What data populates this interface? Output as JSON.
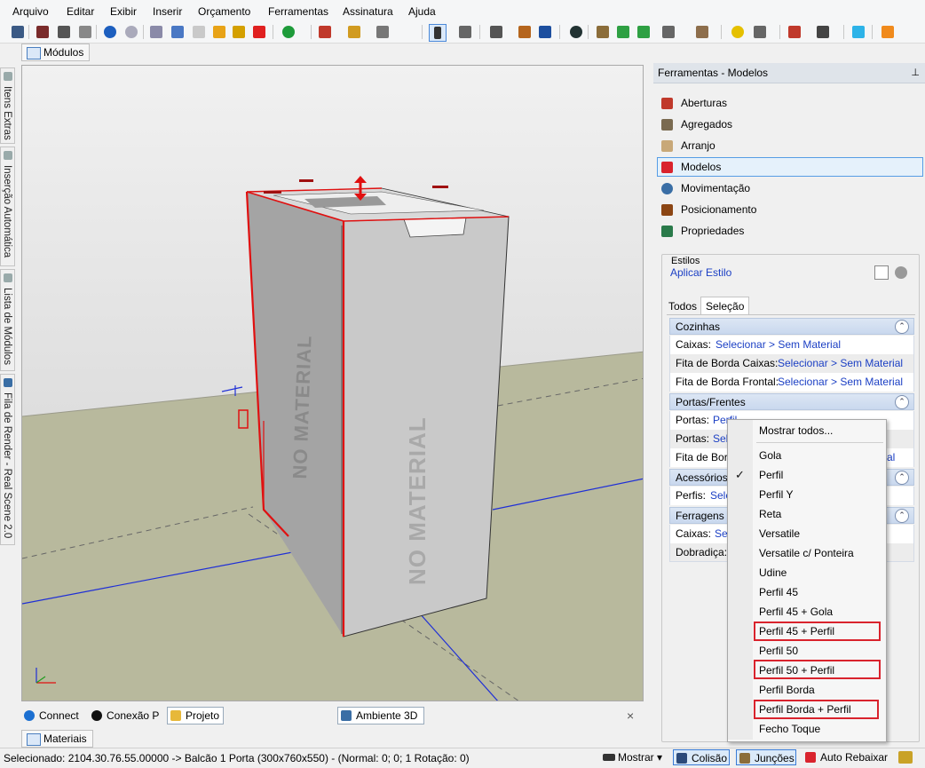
{
  "menu": [
    "Arquivo",
    "Editar",
    "Exibir",
    "Inserir",
    "Orçamento",
    "Ferramentas",
    "Assinatura",
    "Ajuda"
  ],
  "doc_tabs": {
    "modulos": "Módulos",
    "materiais": "Materiais"
  },
  "side_tabs": [
    "Itens Extras",
    "Inserção Automática",
    "Lista de Módulos",
    "Fila de Render - Real Scene 2.0"
  ],
  "viewport": {
    "watermark_front": "NO MATERIAL",
    "watermark_side": "NO MATERIAL"
  },
  "bottom_tabs": {
    "connect": "Connect",
    "conexao": "Conexão P",
    "projeto": "Projeto",
    "ambiente": "Ambiente 3D",
    "close": "×"
  },
  "panel": {
    "title": "Ferramentas - Modelos",
    "pin": "⊥",
    "tools": [
      "Aberturas",
      "Agregados",
      "Arranjo",
      "Modelos",
      "Movimentação",
      "Posicionamento",
      "Propriedades"
    ],
    "estilos_label": "Estilos",
    "aplicar_estilo": "Aplicar Estilo",
    "tabs": [
      "Todos",
      "Seleção"
    ],
    "groups": {
      "cozinhas": {
        "title": "Cozinhas",
        "rows": [
          {
            "label": "Caixas:",
            "value": "Selecionar > Sem Material"
          },
          {
            "label": "Fita de Borda Caixas:",
            "value": "Selecionar > Sem Material"
          },
          {
            "label": "Fita de Borda Frontal:",
            "value": "Selecionar > Sem Material"
          }
        ]
      },
      "portas": {
        "title": "Portas/Frentes",
        "rows": [
          {
            "label": "Portas:",
            "value": "Perfil"
          },
          {
            "label": "Portas:",
            "value": "Sele"
          },
          {
            "label": "Fita de Bord",
            "value": "al"
          }
        ]
      },
      "acessorios": {
        "title": "Acessórios",
        "rows": [
          {
            "label": "Perfis:",
            "value": "Sele"
          }
        ]
      },
      "ferragens": {
        "title": "Ferragens",
        "rows": [
          {
            "label": "Caixas:",
            "value": "Sel"
          },
          {
            "label": "Dobradiça:",
            "value": ""
          }
        ]
      }
    }
  },
  "dropdown": {
    "show_all": "Mostrar todos...",
    "items": [
      "Gola",
      "Perfil",
      "Perfil Y",
      "Reta",
      "Versatile",
      "Versatile c/ Ponteira",
      "Udine",
      "Perfil 45",
      "Perfil 45 + Gola",
      "Perfil 45 + Perfil",
      "Perfil 50",
      "Perfil 50 + Perfil",
      "Perfil Borda",
      "Perfil Borda + Perfil",
      "Fecho Toque"
    ],
    "checked": "Perfil",
    "check_mark": "✓",
    "highlighted": [
      "Perfil 45 + Perfil",
      "Perfil 50 + Perfil",
      "Perfil Borda + Perfil"
    ]
  },
  "status": {
    "text": "Selecionado: 2104.30.76.55.00000 -> Balcão 1 Porta (300x760x550) - (Normal: 0; 0; 1 Rotação: 0)",
    "mostrar": "Mostrar",
    "colisao": "Colisão",
    "juncoes": "Junções",
    "auto_rebaixar": "Auto Rebaixar"
  }
}
